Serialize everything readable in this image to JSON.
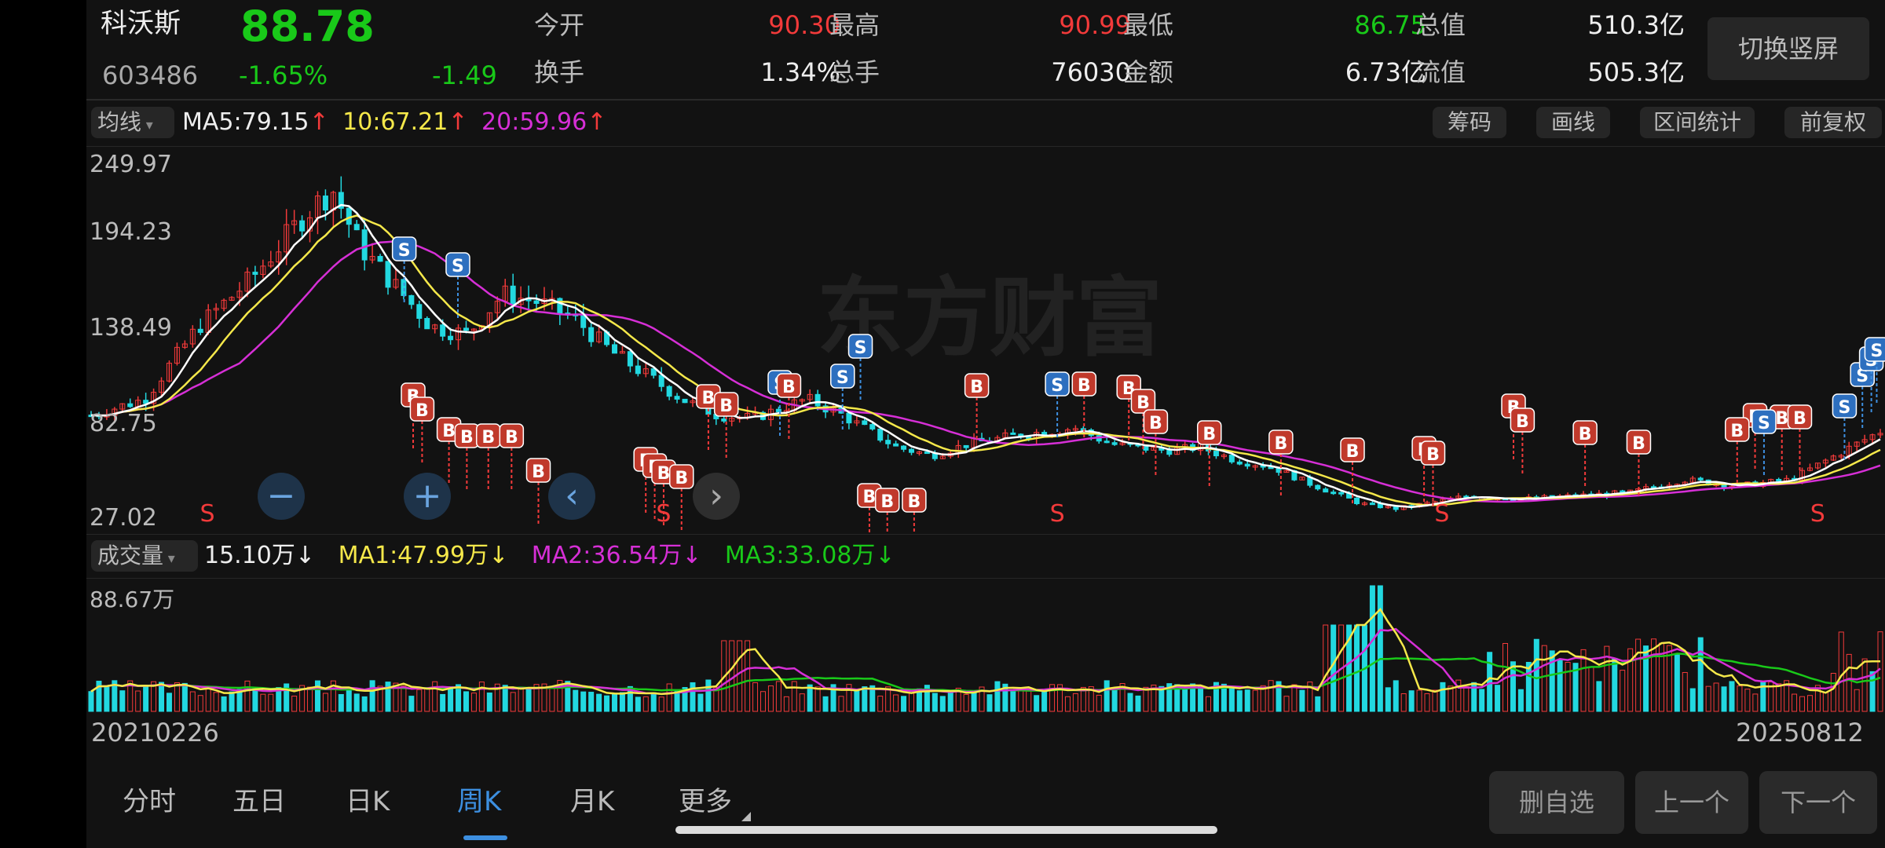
{
  "quote": {
    "name": "科沃斯",
    "code": "603486",
    "price": "88.78",
    "change_pct": "-1.65%",
    "change": "-1.49",
    "stats": [
      {
        "label": "今开",
        "value": "90.30",
        "color": "red"
      },
      {
        "label": "最高",
        "value": "90.99",
        "color": "red"
      },
      {
        "label": "最低",
        "value": "86.75",
        "color": "green"
      },
      {
        "label": "总值",
        "value": "510.3亿",
        "color": "white"
      },
      {
        "label": "换手",
        "value": "1.34%",
        "color": "white"
      },
      {
        "label": "总手",
        "value": "76030",
        "color": "white"
      },
      {
        "label": "金额",
        "value": "6.73亿",
        "color": "white"
      },
      {
        "label": "流值",
        "value": "505.3亿",
        "color": "white"
      }
    ],
    "switch_label": "切换竖屏"
  },
  "price_chart": {
    "indicator_select": "均线",
    "ma5": "MA5:79.15",
    "ma10": "10:67.21",
    "ma20": "20:59.96",
    "arrow_up": "↑",
    "tools": [
      "筹码",
      "画线",
      "区间统计",
      "前复权"
    ],
    "y_labels": [
      "249.97",
      "194.23",
      "138.49",
      "82.75",
      "27.02"
    ],
    "watermark": "东方财富",
    "marker_b": "B",
    "marker_s": "S"
  },
  "volume_chart": {
    "indicator_select": "成交量",
    "vol": "15.10万",
    "ma1": "MA1:47.99万",
    "ma2": "MA2:36.54万",
    "ma3": "MA3:33.08万",
    "arrow_down": "↓",
    "max_label": "88.67万",
    "start_date": "20210226",
    "end_date": "20250812"
  },
  "chart_data": {
    "type": "candlestick",
    "period": "weekly",
    "ylim": [
      27.02,
      249.97
    ],
    "x_range": [
      "20210226",
      "20250812"
    ],
    "colors": {
      "up": "#f23a3a",
      "down": "#22d8e0",
      "ma5": "#ffffff",
      "ma10": "#f5e84a",
      "ma20": "#d62fd6"
    },
    "volume_max": "88.67万"
  },
  "bottom": {
    "tabs": [
      "分时",
      "五日",
      "日K",
      "周K",
      "月K",
      "更多"
    ],
    "active_tab": 3,
    "buttons": [
      "删自选",
      "上一个",
      "下一个"
    ]
  },
  "controls": {
    "zoom_out": "−",
    "zoom_in": "+",
    "prev": "‹",
    "next": "›"
  }
}
